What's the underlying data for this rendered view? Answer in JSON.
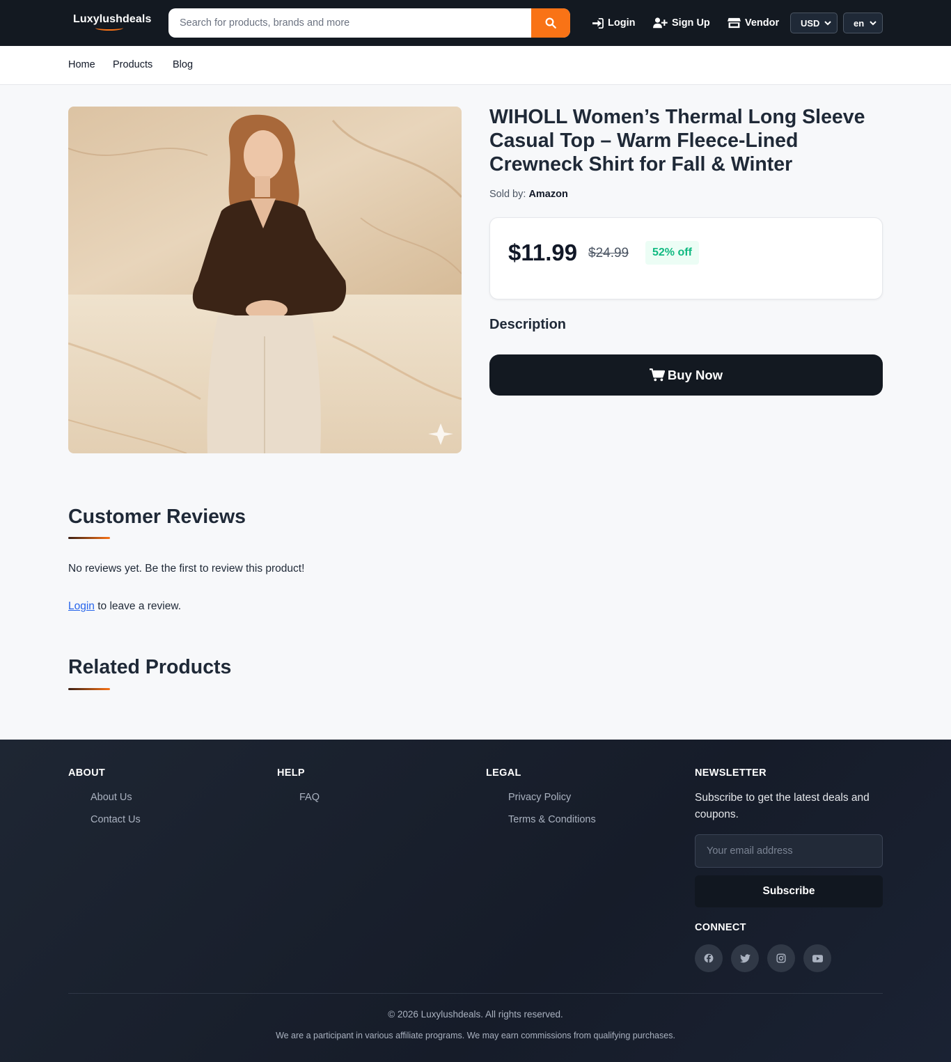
{
  "header": {
    "logo": "Luxylushdeals",
    "search_placeholder": "Search for products, brands and more",
    "login_label": "Login",
    "signup_label": "Sign Up",
    "vendor_label": "Vendor",
    "currency": "USD",
    "language": "en"
  },
  "nav": {
    "items": [
      "Home",
      "Products",
      "Blog"
    ]
  },
  "product": {
    "title": "WIHOLL Women’s Thermal Long Sleeve Casual Top – Warm Fleece-Lined Crewneck Shirt for Fall & Winter",
    "sold_by_label": "Sold by:",
    "seller": "Amazon",
    "price": "$11.99",
    "original_price": "$24.99",
    "discount": "52% off",
    "description_heading": "Description",
    "buy_label": "Buy Now"
  },
  "reviews": {
    "heading": "Customer Reviews",
    "empty_text": "No reviews yet. Be the first to review this product!",
    "login_link": "Login",
    "login_suffix": " to leave a review."
  },
  "related": {
    "heading": "Related Products"
  },
  "footer": {
    "about": {
      "heading": "ABOUT",
      "links": [
        "About Us",
        "Contact Us"
      ]
    },
    "help": {
      "heading": "HELP",
      "links": [
        "FAQ"
      ]
    },
    "legal": {
      "heading": "LEGAL",
      "links": [
        "Privacy Policy",
        "Terms & Conditions"
      ]
    },
    "newsletter": {
      "heading": "NEWSLETTER",
      "text": "Subscribe to get the latest deals and coupons.",
      "email_placeholder": "Your email address",
      "subscribe_label": "Subscribe"
    },
    "connect": {
      "heading": "CONNECT",
      "icons": [
        "facebook-icon",
        "twitter-icon",
        "instagram-icon",
        "youtube-icon"
      ]
    },
    "copyright": "© 2026 Luxylushdeals. All rights reserved.",
    "affiliate": "We are a participant in various affiliate programs. We may earn commissions from qualifying purchases."
  },
  "colors": {
    "accent": "#f97316",
    "dark": "#131921",
    "discount_green": "#10b981"
  }
}
